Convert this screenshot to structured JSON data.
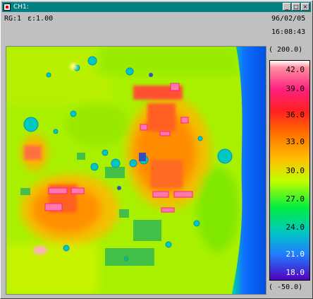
{
  "window": {
    "title": "CH1:",
    "buttons": {
      "minimize": "_",
      "maximize": "□",
      "close": "×"
    }
  },
  "info": {
    "range": "RG:1",
    "emissivity": "ε:1.00",
    "date": "96/02/05",
    "time": "16:08:43"
  },
  "scale": {
    "max_label": "( 200.0)",
    "min_label": "( -50.0)",
    "ticks": [
      "42.0",
      "39.0",
      "36.0",
      "33.0",
      "30.0",
      "27.0",
      "24.0",
      "21.0",
      "18.0"
    ],
    "colors": {
      "hot": "#ff2080",
      "mid": "#ffc000",
      "cool": "#00ee40",
      "cold": "#5000c0"
    }
  }
}
